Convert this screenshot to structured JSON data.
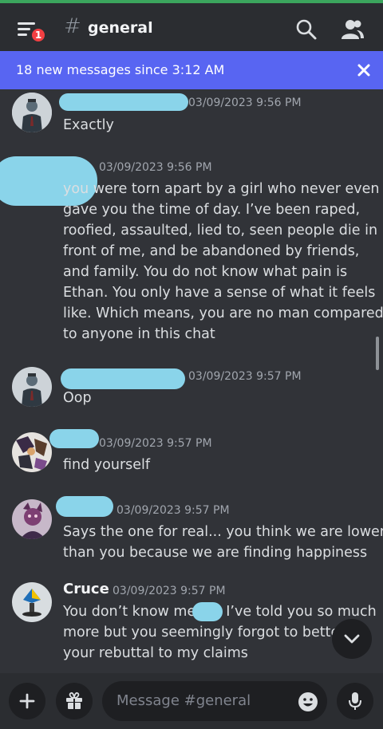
{
  "header": {
    "notification_count": "1",
    "channel_name": "general"
  },
  "banner": {
    "text": "18 new messages since 3:12 AM"
  },
  "messages": [
    {
      "timestamp": "03/09/2023 9:56 PM",
      "lines": [
        "Exactly"
      ]
    },
    {
      "timestamp": "03/09/2023 9:56 PM",
      "lines": [
        "you were torn apart by a girl who never even",
        "gave you the time of day. I’ve been raped,",
        "roofied, assaulted, lied to, seen people die in",
        "front of me, and be abandoned  by friends,",
        "and family. You do not know what pain is",
        "Ethan. You only have a sense of what it feels",
        "like. Which means, you are no man compared",
        "to anyone in this chat"
      ]
    },
    {
      "timestamp": "03/09/2023 9:57 PM",
      "lines": [
        "Oop"
      ]
    },
    {
      "timestamp": "03/09/2023 9:57 PM",
      "lines": [
        "find yourself"
      ]
    },
    {
      "timestamp": "03/09/2023 9:57 PM",
      "lines": [
        "Says the one for real... you think we are lower",
        "than you because we are finding happiness"
      ]
    },
    {
      "author": "Cruce",
      "timestamp": "03/09/2023 9:57 PM",
      "lines": [
        "You don’t know me",
        "more but you seemingly forgot to better f",
        "your rebuttal to my claims"
      ],
      "line1_tail": "I’ve told you so much"
    }
  ],
  "composer": {
    "placeholder": "Message #general"
  },
  "icons": {
    "menu": "hamburger-menu-icon",
    "search": "search-icon",
    "members": "members-icon",
    "close": "close-icon",
    "jump": "chevron-down-icon",
    "add": "plus-icon",
    "gift": "gift-icon",
    "emoji": "emoji-icon",
    "mic": "microphone-icon"
  },
  "colors": {
    "banner": "#5865f2",
    "badge": "#f23f42",
    "background": "#313338",
    "redaction": "#8ad4ea"
  }
}
